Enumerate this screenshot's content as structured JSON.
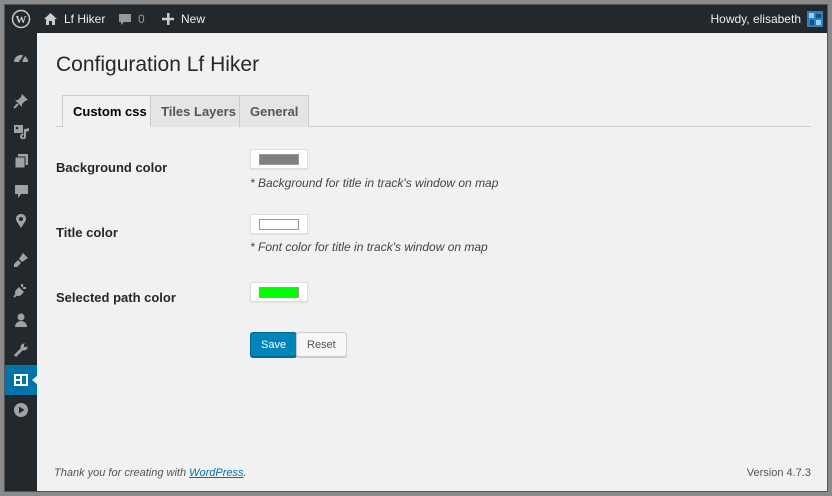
{
  "adminbar": {
    "site_name": "Lf Hiker",
    "comments_count": "0",
    "new_label": "New",
    "greeting": "Howdy, elisabeth"
  },
  "sidebar": {
    "icons": [
      "dashboard-icon",
      "posts-pin-icon",
      "media-icon",
      "pages-icon",
      "comments-icon",
      "location-icon",
      "appearance-brush-icon",
      "plugins-icon",
      "users-icon",
      "tools-wrench-icon",
      "lf-hiker-icon",
      "play-icon"
    ],
    "active_index": 10
  },
  "page": {
    "title": "Configuration Lf Hiker"
  },
  "tabs": [
    {
      "label": "Custom css",
      "active": true
    },
    {
      "label": "Tiles Layers",
      "active": false
    },
    {
      "label": "General",
      "active": false
    }
  ],
  "settings": [
    {
      "label": "Background color",
      "color": "#808080",
      "description": "* Background for title in track's window on map"
    },
    {
      "label": "Title color",
      "color": "#ffffff",
      "description": "* Font color for title in track's window on map"
    },
    {
      "label": "Selected path color",
      "color": "#00ff00",
      "description": ""
    }
  ],
  "buttons": {
    "save": "Save",
    "reset": "Reset"
  },
  "footer": {
    "thanks_prefix": "Thank you for creating with ",
    "thanks_link": "WordPress",
    "thanks_suffix": ".",
    "version": "Version 4.7.3"
  },
  "colors": {
    "adminbar_bg": "#23282d",
    "accent": "#0073aa",
    "primary_button": "#0085ba",
    "page_bg": "#f1f1f1"
  }
}
